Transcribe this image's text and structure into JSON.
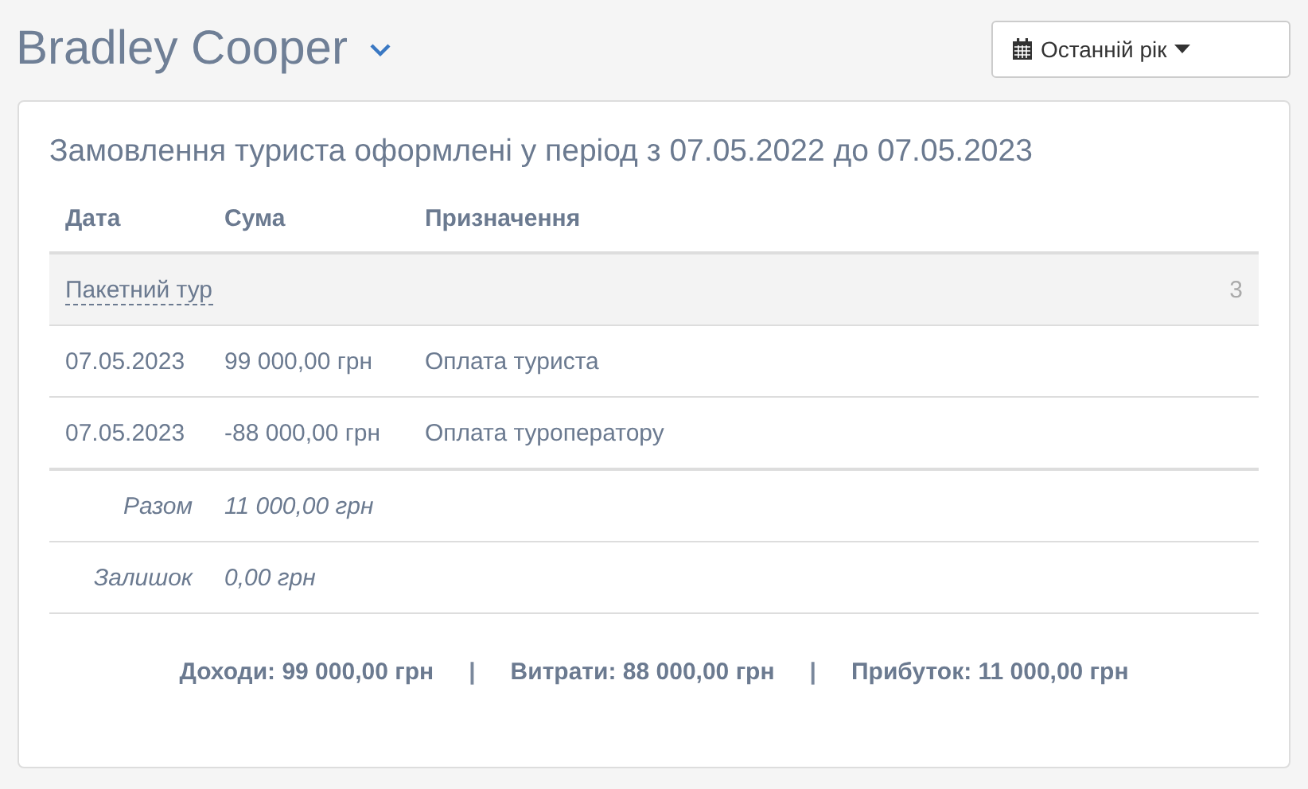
{
  "header": {
    "title": "Bradley Cooper",
    "period_button": "Останній рік"
  },
  "card": {
    "title": "Замовлення туриста оформлені у період з 07.05.2022 до 07.05.2023",
    "table": {
      "columns": [
        "Дата",
        "Сума",
        "Призначення"
      ],
      "group": {
        "name": "Пакетний тур",
        "count": "3"
      },
      "rows": [
        {
          "date": "07.05.2023",
          "amount": "99 000,00 грн",
          "purpose": "Оплата туриста"
        },
        {
          "date": "07.05.2023",
          "amount": "-88 000,00 грн",
          "purpose": "Оплата туроператору"
        }
      ],
      "summary": [
        {
          "label": "Разом",
          "value": "11 000,00 грн"
        },
        {
          "label": "Залишок",
          "value": "0,00 грн"
        }
      ]
    },
    "totals": [
      {
        "kind": "value",
        "text": "Доходи: 99 000,00 грн"
      },
      {
        "kind": "separator",
        "text": "|"
      },
      {
        "kind": "value",
        "text": "Витрати: 88 000,00 грн"
      },
      {
        "kind": "separator",
        "text": "|"
      },
      {
        "kind": "value",
        "text": "Прибуток: 11 000,00 грн"
      }
    ]
  }
}
